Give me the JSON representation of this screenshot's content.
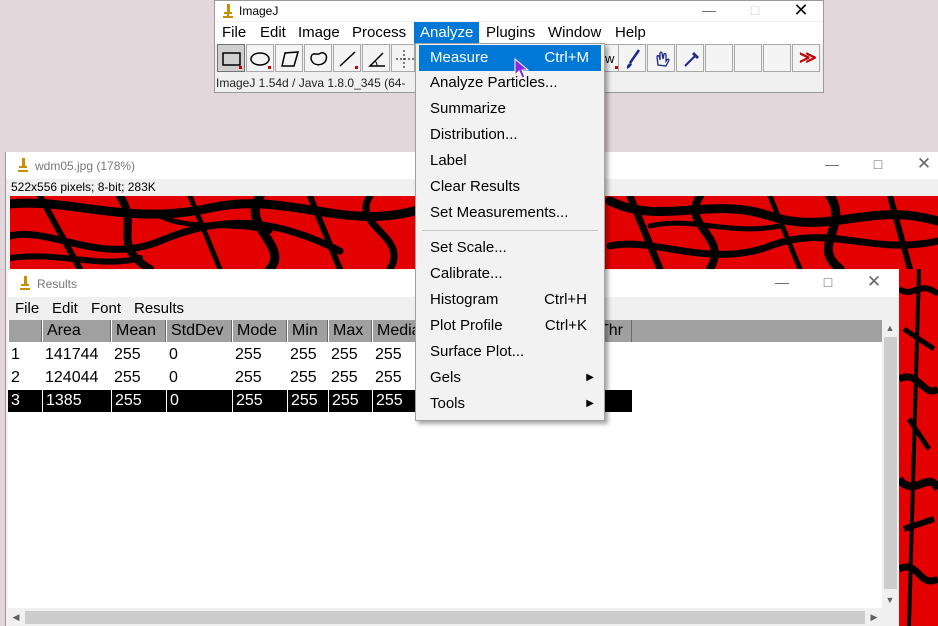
{
  "imagej": {
    "title": "ImageJ",
    "menus": [
      "File",
      "Edit",
      "Image",
      "Process",
      "Analyze",
      "Plugins",
      "Window",
      "Help"
    ],
    "active_menu": "Analyze",
    "status": "ImageJ 1.54d / Java 1.8.0_345 (64-",
    "overflow_label": "≫"
  },
  "image_window": {
    "title": "wdm05.jpg (178%)",
    "info": "522x556 pixels; 8-bit; 283K"
  },
  "results_window": {
    "title": "Results",
    "menus": [
      "File",
      "Edit",
      "Font",
      "Results"
    ],
    "columns": [
      "Area",
      "Mean",
      "StdDev",
      "Mode",
      "Min",
      "Max",
      "Media"
    ],
    "extra_column": "Thr",
    "rows": [
      {
        "index": "1",
        "values": [
          "141744",
          "255",
          "0",
          "255",
          "255",
          "255",
          "255"
        ]
      },
      {
        "index": "2",
        "values": [
          "124044",
          "255",
          "0",
          "255",
          "255",
          "255",
          "255"
        ]
      },
      {
        "index": "3",
        "values": [
          "1385",
          "255",
          "0",
          "255",
          "255",
          "255",
          "255"
        ]
      }
    ],
    "selected_row": "3"
  },
  "analyze_menu": {
    "items": [
      {
        "label": "Measure",
        "shortcut": "Ctrl+M"
      },
      {
        "label": "Analyze Particles...",
        "shortcut": ""
      },
      {
        "label": "Summarize",
        "shortcut": ""
      },
      {
        "label": "Distribution...",
        "shortcut": ""
      },
      {
        "label": "Label",
        "shortcut": ""
      },
      {
        "label": "Clear Results",
        "shortcut": ""
      },
      {
        "label": "Set Measurements...",
        "shortcut": ""
      },
      {
        "label": "Set Scale...",
        "shortcut": ""
      },
      {
        "label": "Calibrate...",
        "shortcut": ""
      },
      {
        "label": "Histogram",
        "shortcut": "Ctrl+H"
      },
      {
        "label": "Plot Profile",
        "shortcut": "Ctrl+K"
      },
      {
        "label": "Surface Plot...",
        "shortcut": ""
      },
      {
        "label": "Gels",
        "shortcut": ""
      },
      {
        "label": "Tools",
        "shortcut": ""
      }
    ],
    "highlighted": "Measure"
  },
  "colors": {
    "menu_highlight": "#0078d7",
    "image_red": "#e30000",
    "table_header": "#a0a0a0"
  }
}
